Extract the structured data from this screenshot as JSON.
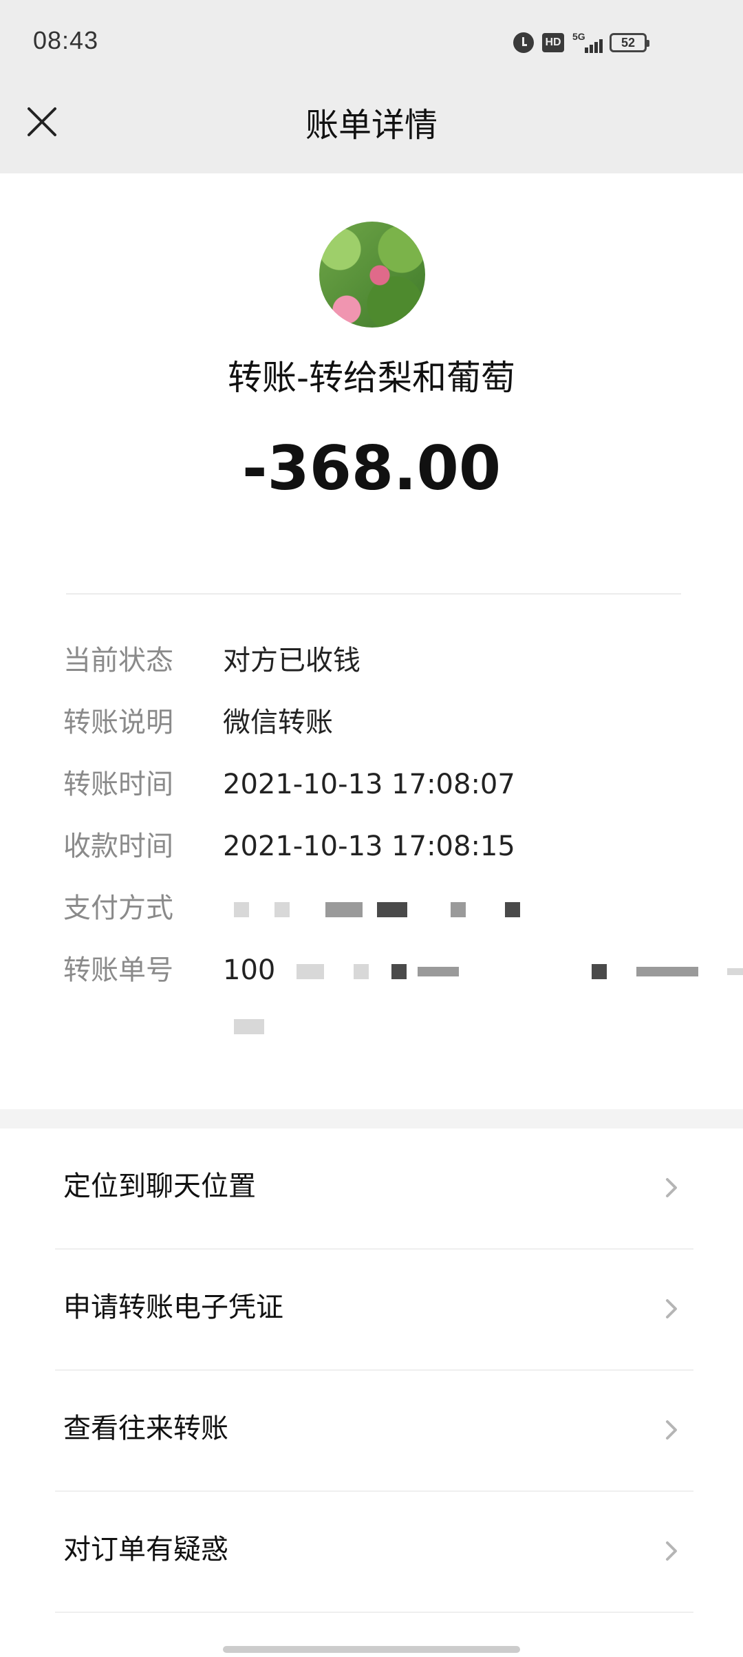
{
  "status_bar": {
    "time": "08:43",
    "hd_label": "HD",
    "network_label": "5G",
    "battery_level": "52"
  },
  "header": {
    "title": "账单详情"
  },
  "summary": {
    "title": "转账-转给梨和葡萄",
    "amount": "-368.00"
  },
  "details": [
    {
      "label": "当前状态",
      "value": "对方已收钱"
    },
    {
      "label": "转账说明",
      "value": "微信转账"
    },
    {
      "label": "转账时间",
      "value": "2021-10-13 17:08:07"
    },
    {
      "label": "收款时间",
      "value": "2021-10-13 17:08:15"
    },
    {
      "label": "支付方式",
      "value": ""
    },
    {
      "label": "转账单号",
      "value": "100"
    }
  ],
  "actions": [
    {
      "label": "定位到聊天位置"
    },
    {
      "label": "申请转账电子凭证"
    },
    {
      "label": "查看往来转账"
    },
    {
      "label": "对订单有疑惑"
    }
  ],
  "icons": {
    "close": "close-icon",
    "chevron": "chevron-right-icon",
    "alarm": "alarm-icon",
    "battery": "battery-icon"
  },
  "colors": {
    "header_bg": "#ededed",
    "label_gray": "#8a8a8a",
    "text": "#111111"
  }
}
